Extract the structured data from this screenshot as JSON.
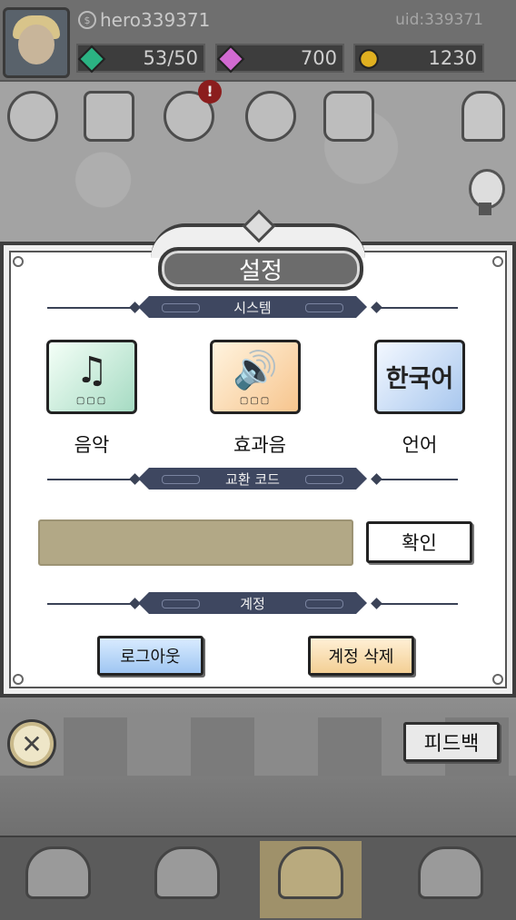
{
  "header": {
    "nickname": "hero339371",
    "uid": "uid:339371",
    "resources": [
      {
        "icon": "green-gem-icon",
        "value": "53/50",
        "color": "#2bb383"
      },
      {
        "icon": "pink-gem-icon",
        "value": "700",
        "color": "#d26ad2"
      },
      {
        "icon": "gold-coin-icon",
        "value": "1230",
        "color": "#e0b020"
      }
    ]
  },
  "background_nav": {
    "badge": "!"
  },
  "settings": {
    "title": "설정",
    "system_section": "시스템",
    "options": [
      {
        "label": "음악",
        "icon": "music-note-icon",
        "glyph": "♫",
        "dots": "▢▢▢"
      },
      {
        "label": "효과음",
        "icon": "speaker-icon",
        "glyph": "🔊",
        "dots": "▢▢▢"
      },
      {
        "label": "언어",
        "icon": "language-icon",
        "glyph": "한국어"
      }
    ],
    "code_section": "교환 코드",
    "code_value": "",
    "confirm_label": "확인",
    "account_section": "계정",
    "logout_label": "로그아웃",
    "delete_label": "계정 삭제"
  },
  "footer": {
    "close_glyph": "✕",
    "feedback_label": "피드백"
  }
}
